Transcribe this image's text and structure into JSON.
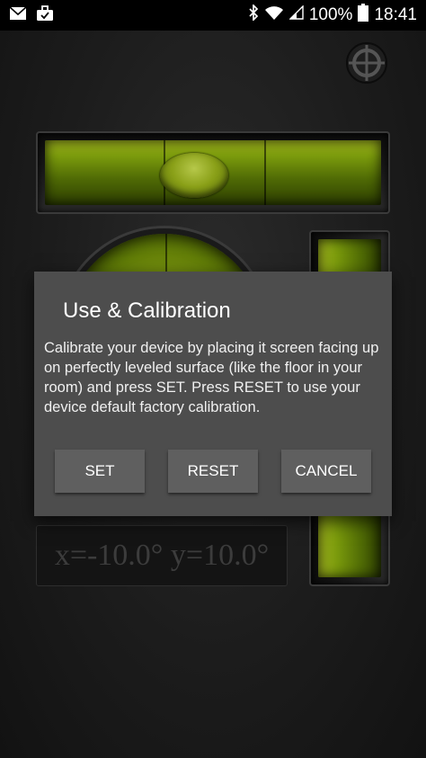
{
  "status_bar": {
    "battery": "100%",
    "time": "18:41",
    "icons": [
      "mail-icon",
      "briefcase-icon",
      "bluetooth-icon",
      "wifi-icon",
      "signal-icon",
      "battery-icon"
    ]
  },
  "level": {
    "readout": "x=-10.0° y=10.0°"
  },
  "dialog": {
    "title": "Use & Calibration",
    "body": "Calibrate your device by placing it screen facing up on perfectly leveled surface (like the floor in your room) and press SET. Press RESET to use your device default factory calibration.",
    "buttons": {
      "set": "SET",
      "reset": "RESET",
      "cancel": "CANCEL"
    }
  },
  "colors": {
    "dialog_bg": "#4d4d4d",
    "button_bg": "#5f5f5f",
    "level_green": "#7a9a0c"
  }
}
